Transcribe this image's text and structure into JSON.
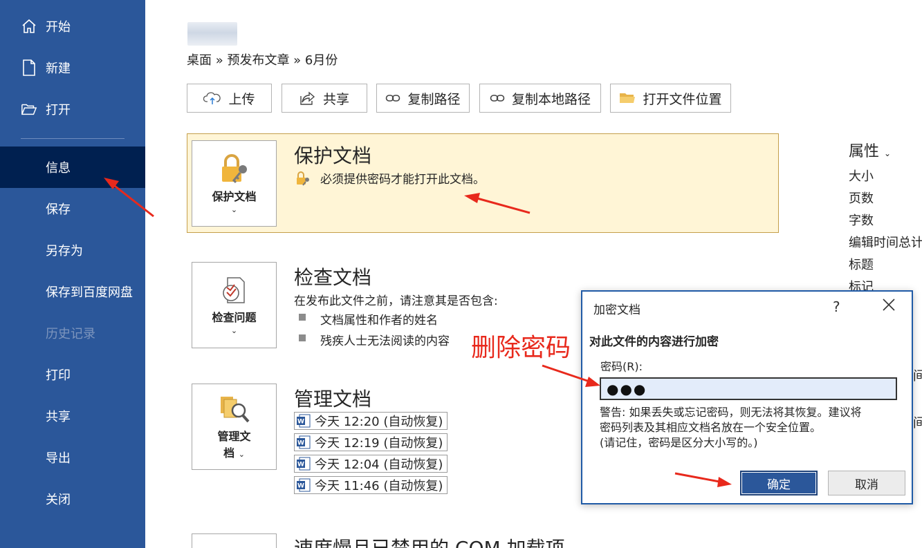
{
  "sidebar": {
    "items": [
      {
        "label": "开始",
        "icon": "home-icon"
      },
      {
        "label": "新建",
        "icon": "new-document-icon"
      },
      {
        "label": "打开",
        "icon": "folder-open-icon"
      },
      {
        "label": "信息"
      },
      {
        "label": "保存"
      },
      {
        "label": "另存为"
      },
      {
        "label": "保存到百度网盘"
      },
      {
        "label": "历史记录"
      },
      {
        "label": "打印"
      },
      {
        "label": "共享"
      },
      {
        "label": "导出"
      },
      {
        "label": "关闭"
      }
    ]
  },
  "main": {
    "breadcrumb": "桌面 » 预发布文章 » 6月份",
    "toolbar": {
      "upload": "上传",
      "share": "共享",
      "copy_path": "复制路径",
      "copy_local_path": "复制本地路径",
      "open_location": "打开文件位置"
    },
    "protect": {
      "tile_label": "保护文档",
      "title": "保护文档",
      "desc": "必须提供密码才能打开此文档。"
    },
    "inspect": {
      "tile_label": "检查问题",
      "title": "检查文档",
      "desc": "在发布此文件之前，请注意其是否包含:",
      "bullets": [
        "文档属性和作者的姓名",
        "残疾人士无法阅读的内容"
      ]
    },
    "manage": {
      "tile_label_1": "管理文",
      "tile_label_2": "档",
      "title": "管理文档",
      "versions": [
        "今天 12:20 (自动恢复)",
        "今天 12:19 (自动恢复)",
        "今天 12:04 (自动恢复)",
        "今天 11:46 (自动恢复)"
      ]
    },
    "com_title": "速度慢且已禁用的 COM 加载项"
  },
  "properties": {
    "title": "属性",
    "items": [
      "大小",
      "页数",
      "字数",
      "编辑时间总计",
      "标题",
      "标记"
    ],
    "partial": [
      "间",
      "间"
    ]
  },
  "annotation": "删除密码",
  "dialog": {
    "title": "加密文档",
    "help": "?",
    "heading": "对此文件的内容进行加密",
    "label": "密码(R):",
    "password": "●●●",
    "warning_1": "警告: 如果丢失或忘记密码，则无法将其恢复。建议将",
    "warning_2": "密码列表及其相应文档名放在一个安全位置。",
    "warning_3": "(请记住，密码是区分大小写的。)",
    "ok": "确定",
    "cancel": "取消"
  },
  "colors": {
    "sidebar": "#2b579a",
    "sidebar_active": "#002050",
    "highlight_bg": "#fff5d6",
    "annotation": "#e8291c"
  }
}
